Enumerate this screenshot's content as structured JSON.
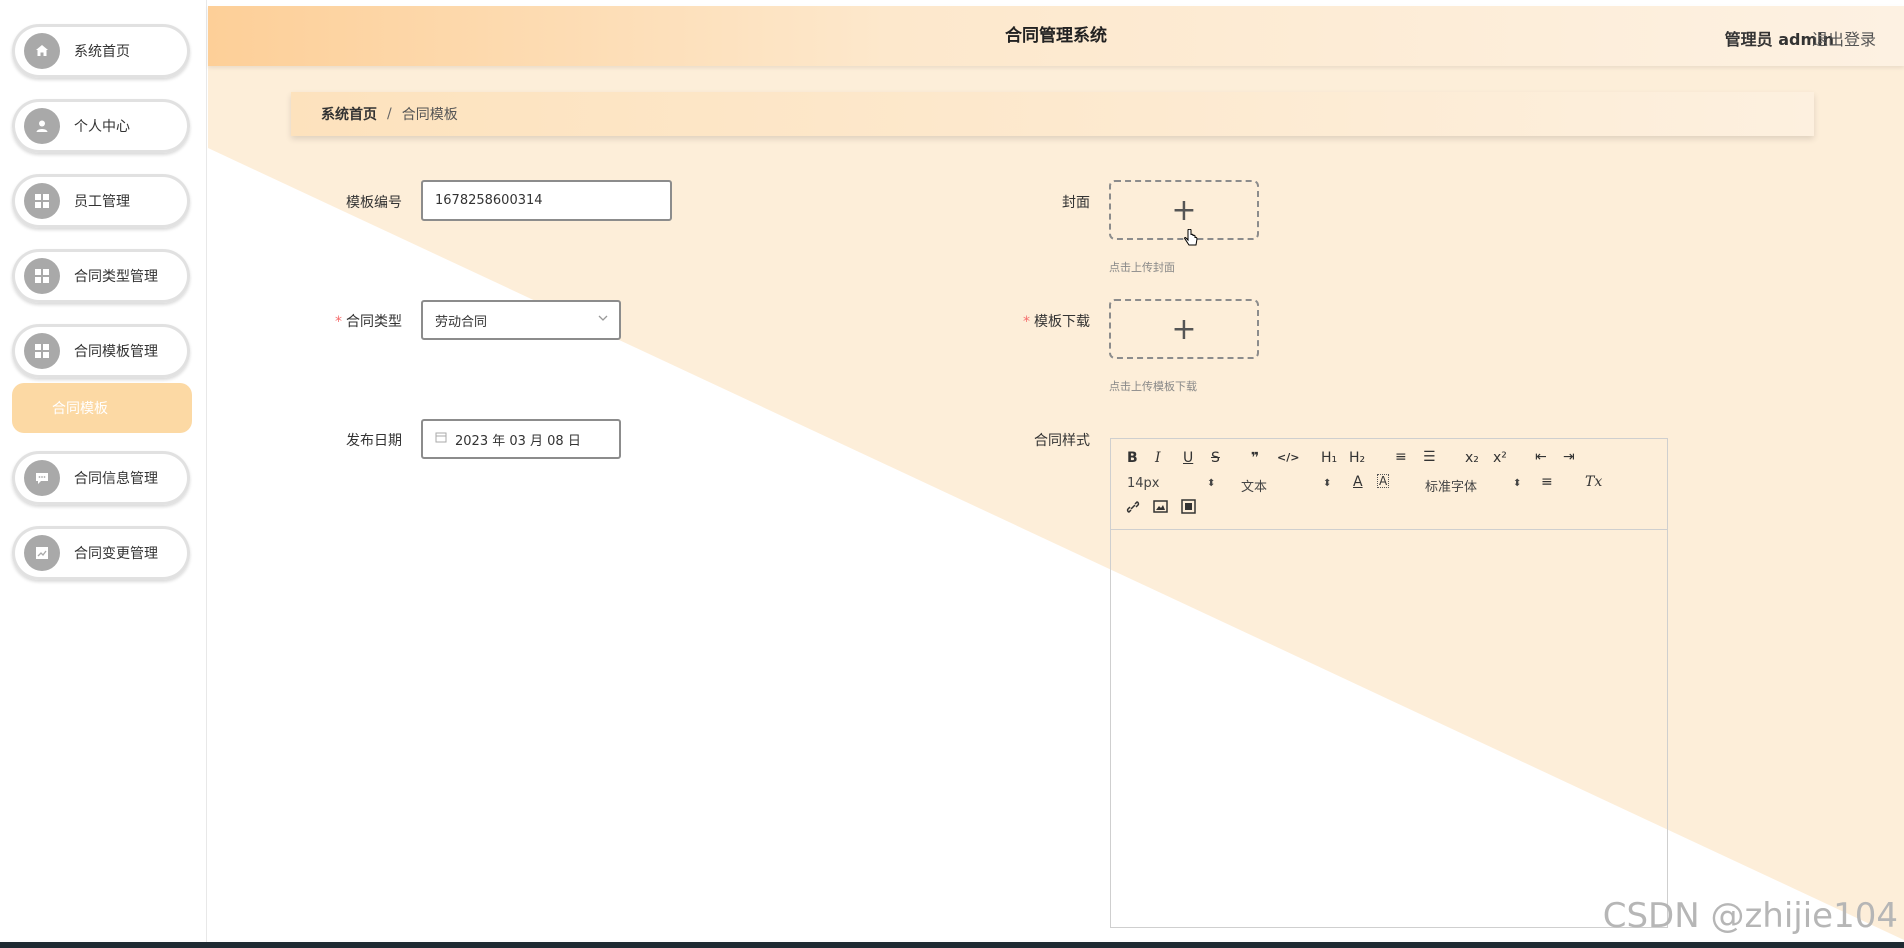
{
  "sidebar": {
    "items": [
      {
        "label": "系统首页",
        "icon": "home-icon"
      },
      {
        "label": "个人中心",
        "icon": "user-icon"
      },
      {
        "label": "员工管理",
        "icon": "grid-icon"
      },
      {
        "label": "合同类型管理",
        "icon": "grid-icon"
      },
      {
        "label": "合同模板管理",
        "icon": "grid-icon"
      },
      {
        "label": "合同信息管理",
        "icon": "chat-icon"
      },
      {
        "label": "合同变更管理",
        "icon": "chart-icon"
      }
    ],
    "active_submenu": "合同模板"
  },
  "header": {
    "title": "合同管理系统",
    "user_label": "管理员 admin",
    "logout_label": "退出登录"
  },
  "breadcrumb": {
    "home": "系统首页",
    "separator": "/",
    "current": "合同模板"
  },
  "form": {
    "template_no_label": "模板编号",
    "template_no_value": "1678258600314",
    "contract_type_label": "合同类型",
    "contract_type_value": "劳动合同",
    "publish_date_label": "发布日期",
    "publish_date_value": "2023 年 03 月 08 日",
    "cover_label": "封面",
    "cover_tip": "点击上传封面",
    "template_download_label": "模板下载",
    "template_download_tip": "点击上传模板下载",
    "contract_style_label": "合同样式",
    "required_mark": "*",
    "upload_plus": "+"
  },
  "editor": {
    "font_size": "14px",
    "paragraph": "文本",
    "font_family": "标准字体",
    "buttons": {
      "bold": "B",
      "italic": "I",
      "underline": "U",
      "strike": "S",
      "quote": "❞",
      "code": "</>",
      "h1": "H₁",
      "h2": "H₂",
      "ordered": "≡",
      "bullet": "☰",
      "sub": "x₂",
      "sup": "x²",
      "outdent": "⇤",
      "indent": "⇥",
      "color": "A",
      "bg": "A",
      "align": "≡",
      "clean": "Tx",
      "link": "🔗",
      "image": "▣",
      "video": "▦"
    }
  },
  "watermark": "CSDN @zhijie104"
}
